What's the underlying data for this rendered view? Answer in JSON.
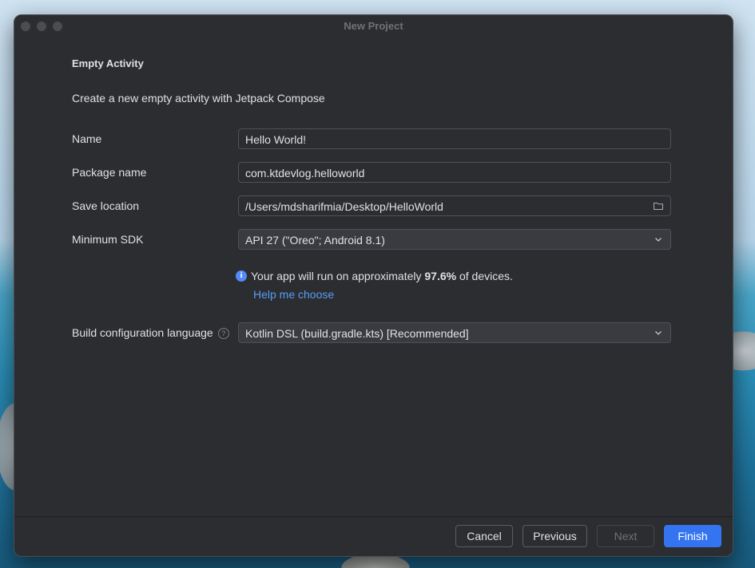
{
  "window": {
    "title": "New Project"
  },
  "header": {
    "heading": "Empty Activity",
    "description": "Create a new empty activity with Jetpack Compose"
  },
  "form": {
    "name_label": "Name",
    "name_value": "Hello World!",
    "package_label": "Package name",
    "package_value": "com.ktdevlog.helloworld",
    "save_label": "Save location",
    "save_value": "/Users/mdsharifmia/Desktop/HelloWorld",
    "sdk_label": "Minimum SDK",
    "sdk_value": "API 27 (\"Oreo\"; Android 8.1)",
    "info_prefix": "Your app will run on approximately ",
    "info_percent": "97.6%",
    "info_suffix": " of devices.",
    "help_link": "Help me choose",
    "build_label": "Build configuration language",
    "build_value": "Kotlin DSL (build.gradle.kts) [Recommended]"
  },
  "footer": {
    "cancel": "Cancel",
    "previous": "Previous",
    "next": "Next",
    "finish": "Finish"
  },
  "colors": {
    "accent": "#3574f0",
    "link": "#589df6",
    "dialog_bg": "#2b2d30",
    "text": "#dfe1e5"
  },
  "icons": [
    "folder-icon",
    "chevron-down-icon",
    "info-icon",
    "help-icon"
  ]
}
